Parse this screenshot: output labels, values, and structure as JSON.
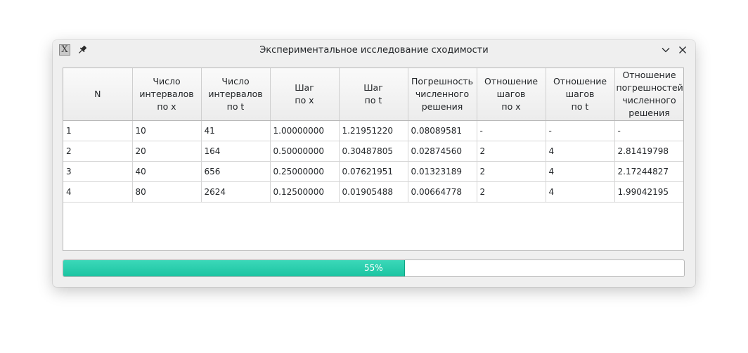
{
  "window": {
    "title": "Экспериментальное исследование сходимости"
  },
  "icons": {
    "app": "x-app-icon",
    "pin": "pin-icon",
    "minimize": "chevron-down-icon",
    "close": "close-icon"
  },
  "table": {
    "headers": [
      "N",
      "Число\nинтервалов\nпо x",
      "Число\nинтервалов\nпо t",
      "Шаг\nпо x",
      "Шаг\nпо t",
      "Погрешность\nчисленного\nрешения",
      "Отношение\nшагов\nпо x",
      "Отношение\nшагов\nпо t",
      "Отношение\nпогрешностей\nчисленного\nрешения"
    ],
    "rows": [
      [
        "1",
        "10",
        "41",
        "1.00000000",
        "1.21951220",
        "0.08089581",
        "-",
        "-",
        "-"
      ],
      [
        "2",
        "20",
        "164",
        "0.50000000",
        "0.30487805",
        "0.02874560",
        "2",
        "4",
        "2.81419798"
      ],
      [
        "3",
        "40",
        "656",
        "0.25000000",
        "0.07621951",
        "0.01323189",
        "2",
        "4",
        "2.17244827"
      ],
      [
        "4",
        "80",
        "2624",
        "0.12500000",
        "0.01905488",
        "0.00664778",
        "2",
        "4",
        "1.99042195"
      ]
    ]
  },
  "progress": {
    "value": 55,
    "label": "55%",
    "color": "#1cc4a2"
  }
}
